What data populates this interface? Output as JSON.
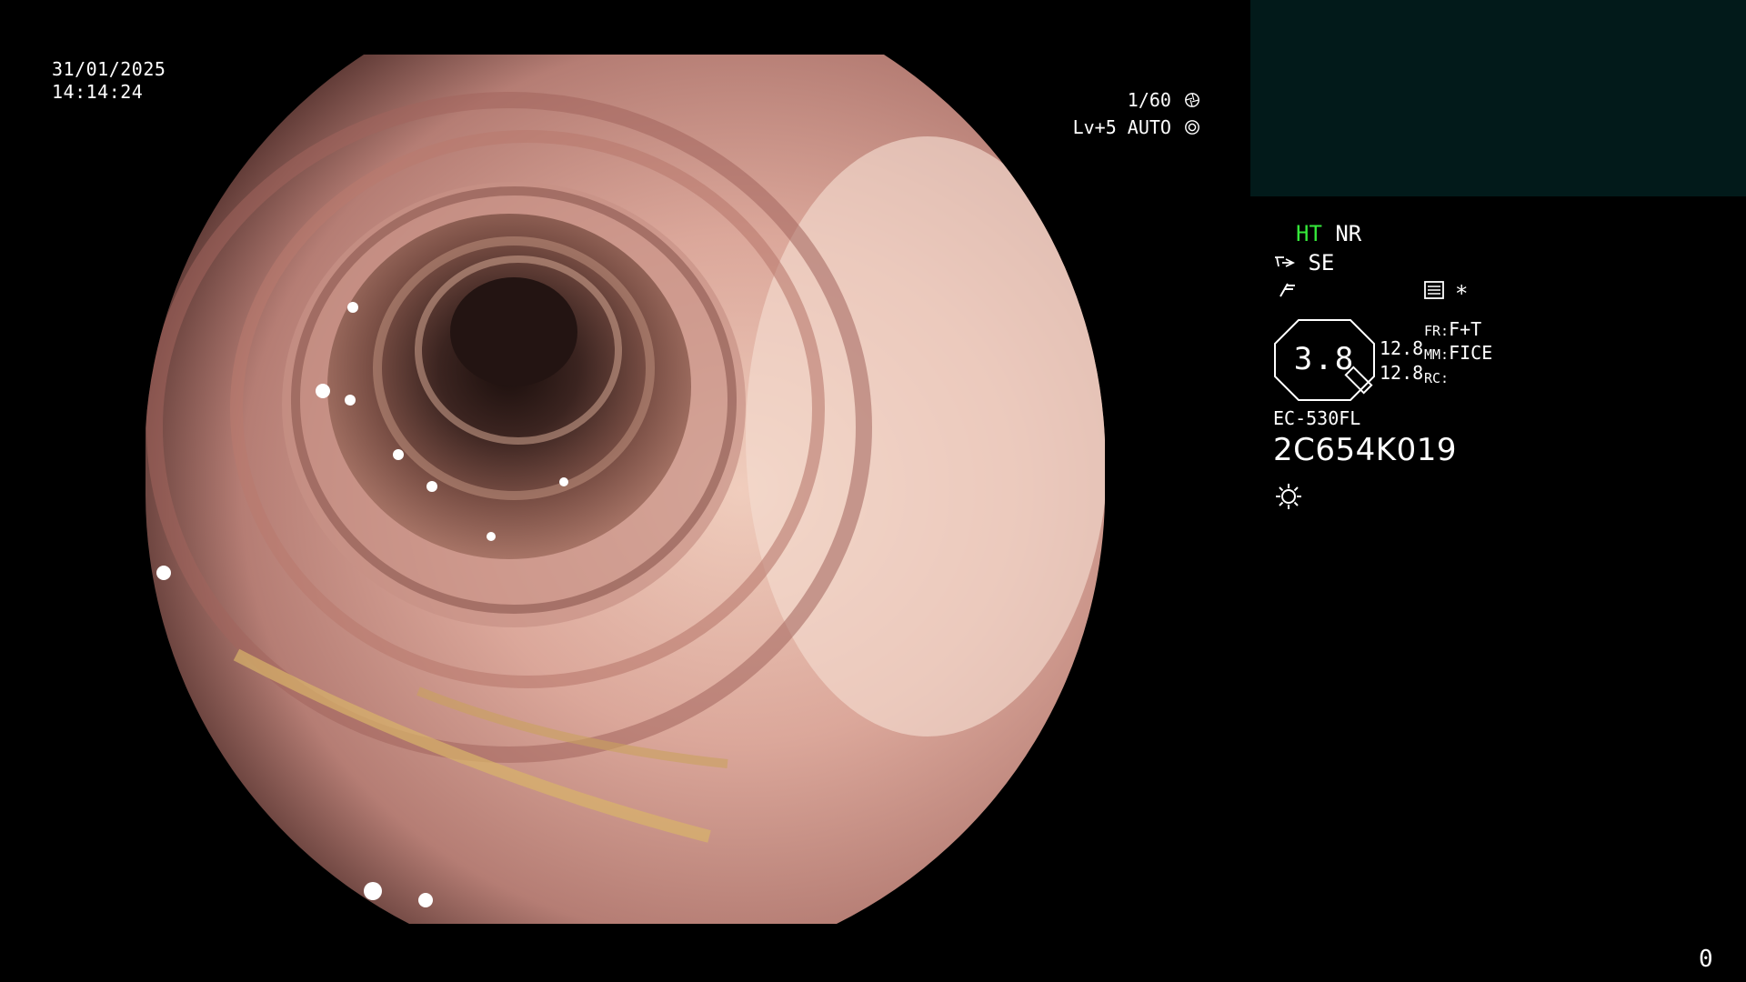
{
  "datetime": {
    "date": "31/01/2025",
    "time": "14:14:24"
  },
  "readouts": {
    "shutter": "1/60",
    "shutter_icon": "aperture-icon",
    "level": "Lv+5 AUTO",
    "level_icon": "auto-iris-icon"
  },
  "image_panel": {
    "type": "endoscopic-lumen-view"
  },
  "settings": {
    "ht": "HT",
    "nr": "NR",
    "se": "SE",
    "asterisk": "*",
    "icons": [
      "scope-tip-icon",
      "freeze-icon",
      "record-icon",
      "light-icon"
    ]
  },
  "gauge": {
    "value": "3.8",
    "line1": "12.8",
    "line2": "12.8"
  },
  "modes": {
    "fr_label": "FR:",
    "fr_value": "F+T",
    "mm_label": "MM:",
    "mm_value": "FICE",
    "rc_label": "RC:",
    "rc_value": ""
  },
  "device": {
    "model": "EC-530FL",
    "serial": "2C654K019"
  },
  "counter": "0",
  "colors": {
    "background": "#000000",
    "thumbnail_panel": "#021a1a",
    "ht_green": "#35e83a",
    "text": "#ffffff"
  }
}
